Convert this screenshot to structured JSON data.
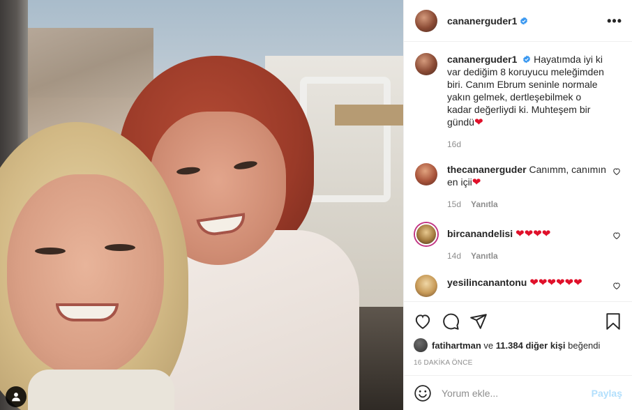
{
  "post": {
    "username": "cananerguder1",
    "more_label": "•••"
  },
  "caption": {
    "username": "cananerguder1",
    "text": "Hayatımda iyi ki var dediğim 8 koruyucu meleğimden biri. Canım Ebrum seninle normale yakın gelmek, dertleşebilmek o kadar değerliydi ki. Muhteşem bir gündü",
    "emoji": "❤",
    "age": "16d"
  },
  "comments": [
    {
      "username": "thecananerguder",
      "text": "Canımm, canımın en içii",
      "emoji": "❤",
      "age": "15d",
      "reply": "Yanıtla"
    },
    {
      "username": "bircanandelisi",
      "text": "",
      "emoji": "❤❤❤❤",
      "age": "14d",
      "reply": "Yanıtla"
    },
    {
      "username": "yesilincanantonu",
      "text": "",
      "emoji": "❤❤❤❤❤❤",
      "age": "",
      "reply": ""
    }
  ],
  "likes": {
    "user": "fatihartman",
    "connector": "ve",
    "others": "11.384 diğer kişi",
    "suffix": "beğendi"
  },
  "timestamp": "16 DAKİKA ÖNCE",
  "composer": {
    "placeholder": "Yorum ekle...",
    "post_label": "Paylaş"
  },
  "colors": {
    "verified": "#3897f0",
    "heart_emoji": "#e0102a",
    "post_button_disabled": "#b2dffc",
    "muted": "#8e8e8e"
  }
}
